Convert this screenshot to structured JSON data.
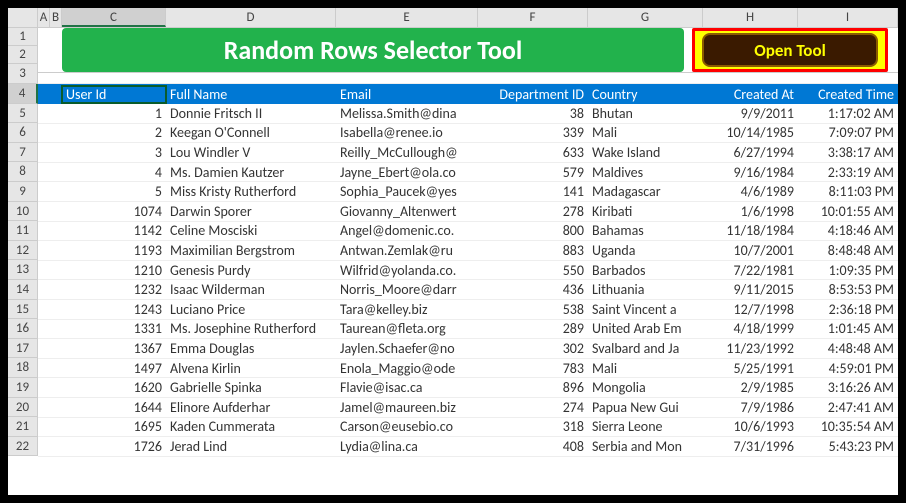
{
  "title": "Random Rows Selector Tool",
  "button_label": "Open Tool",
  "columns": [
    "A",
    "B",
    "C",
    "D",
    "E",
    "F",
    "G",
    "H",
    "I"
  ],
  "selected_col": "C",
  "rows": [
    "1",
    "2",
    "3",
    "4",
    "5",
    "6",
    "7",
    "8",
    "9",
    "10",
    "11",
    "12",
    "13",
    "14",
    "15",
    "16",
    "17",
    "18",
    "19",
    "20",
    "21",
    "22"
  ],
  "selected_row": "4",
  "headers": {
    "user_id": "User Id",
    "full_name": "Full Name",
    "email": "Email",
    "dept": "Department ID",
    "country": "Country",
    "created_at": "Created At",
    "created_time": "Created Time"
  },
  "data": [
    {
      "id": "1",
      "name": "Donnie Fritsch II",
      "email": "Melissa.Smith@dina",
      "dept": "38",
      "country": "Bhutan",
      "date": "9/9/2011",
      "time": "1:17:02 AM"
    },
    {
      "id": "2",
      "name": "Keegan O'Connell",
      "email": "Isabella@renee.io",
      "dept": "339",
      "country": "Mali",
      "date": "10/14/1985",
      "time": "7:09:07 PM"
    },
    {
      "id": "3",
      "name": "Lou Windler V",
      "email": "Reilly_McCullough@",
      "dept": "633",
      "country": "Wake Island",
      "date": "6/27/1994",
      "time": "3:38:17 AM"
    },
    {
      "id": "4",
      "name": "Ms. Damien Kautzer",
      "email": "Jayne_Ebert@ola.co",
      "dept": "579",
      "country": "Maldives",
      "date": "9/16/1984",
      "time": "2:33:19 AM"
    },
    {
      "id": "5",
      "name": "Miss Kristy Rutherford",
      "email": "Sophia_Paucek@yes",
      "dept": "141",
      "country": "Madagascar",
      "date": "4/6/1989",
      "time": "8:11:03 PM"
    },
    {
      "id": "1074",
      "name": "Darwin Sporer",
      "email": "Giovanny_Altenwert",
      "dept": "278",
      "country": "Kiribati",
      "date": "1/6/1998",
      "time": "10:01:55 AM"
    },
    {
      "id": "1142",
      "name": "Celine Mosciski",
      "email": "Angel@domenic.co.",
      "dept": "800",
      "country": "Bahamas",
      "date": "11/18/1984",
      "time": "4:18:46 AM"
    },
    {
      "id": "1193",
      "name": "Maximilian Bergstrom",
      "email": "Antwan.Zemlak@ru",
      "dept": "883",
      "country": "Uganda",
      "date": "10/7/2001",
      "time": "8:48:48 AM"
    },
    {
      "id": "1210",
      "name": "Genesis Purdy",
      "email": "Wilfrid@yolanda.co.",
      "dept": "550",
      "country": "Barbados",
      "date": "7/22/1981",
      "time": "1:09:35 PM"
    },
    {
      "id": "1232",
      "name": "Isaac Wilderman",
      "email": "Norris_Moore@darr",
      "dept": "436",
      "country": "Lithuania",
      "date": "9/11/2015",
      "time": "8:53:53 PM"
    },
    {
      "id": "1243",
      "name": "Luciano Price",
      "email": "Tara@kelley.biz",
      "dept": "538",
      "country": "Saint Vincent a",
      "date": "12/7/1998",
      "time": "2:36:18 PM"
    },
    {
      "id": "1331",
      "name": "Ms. Josephine Rutherford",
      "email": "Taurean@fleta.org",
      "dept": "289",
      "country": "United Arab Em",
      "date": "4/18/1999",
      "time": "1:01:45 AM"
    },
    {
      "id": "1367",
      "name": "Emma Douglas",
      "email": "Jaylen.Schaefer@no",
      "dept": "302",
      "country": "Svalbard and Ja",
      "date": "11/23/1992",
      "time": "4:48:48 AM"
    },
    {
      "id": "1497",
      "name": "Alvena Kirlin",
      "email": "Enola_Maggio@ode",
      "dept": "783",
      "country": "Mali",
      "date": "5/25/1991",
      "time": "4:59:01 PM"
    },
    {
      "id": "1620",
      "name": "Gabrielle Spinka",
      "email": "Flavie@isac.ca",
      "dept": "896",
      "country": "Mongolia",
      "date": "2/9/1985",
      "time": "3:16:26 AM"
    },
    {
      "id": "1644",
      "name": "Elinore Aufderhar",
      "email": "Jamel@maureen.biz",
      "dept": "274",
      "country": "Papua New Gui",
      "date": "7/9/1986",
      "time": "2:47:41 AM"
    },
    {
      "id": "1695",
      "name": "Kaden Cummerata",
      "email": "Carson@eusebio.co",
      "dept": "318",
      "country": "Sierra Leone",
      "date": "10/6/1993",
      "time": "10:35:54 AM"
    },
    {
      "id": "1726",
      "name": "Jerad Lind",
      "email": "Lydia@lina.ca",
      "dept": "408",
      "country": "Serbia and Mon",
      "date": "7/31/1996",
      "time": "5:43:23 PM"
    }
  ]
}
